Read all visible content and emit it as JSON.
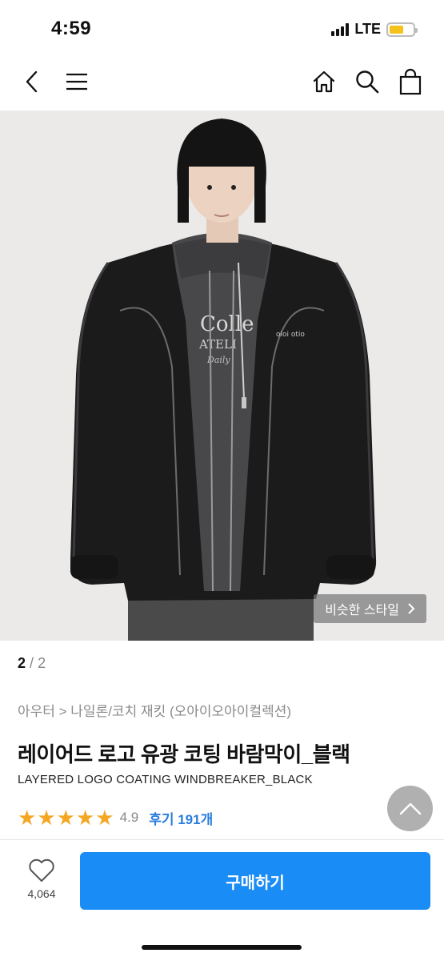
{
  "status": {
    "time": "4:59",
    "network": "LTE",
    "battery_level": 0.6,
    "battery_color": "#f4c21a"
  },
  "nav": {
    "icons": [
      "back-icon",
      "menu-icon",
      "home-icon",
      "search-icon",
      "cart-icon"
    ]
  },
  "product_image": {
    "similar_style_label": "비슷한 스타일",
    "current_page": "2",
    "page_separator": "/",
    "total_pages": "2"
  },
  "product": {
    "breadcrumb": "아우터 > 나일론/코치 재킷 (오아이오아이컬렉션)",
    "title": "레이어드 로고 유광 코팅 바람막이_블랙",
    "subtitle": "LAYERED LOGO COATING WINDBREAKER_BLACK",
    "rating": "4.9",
    "rating_stars": 5,
    "reviews_label": "후기 191개"
  },
  "bottom_bar": {
    "like_count": "4,064",
    "buy_label": "구매하기",
    "accent_color": "#1a8cf5"
  }
}
